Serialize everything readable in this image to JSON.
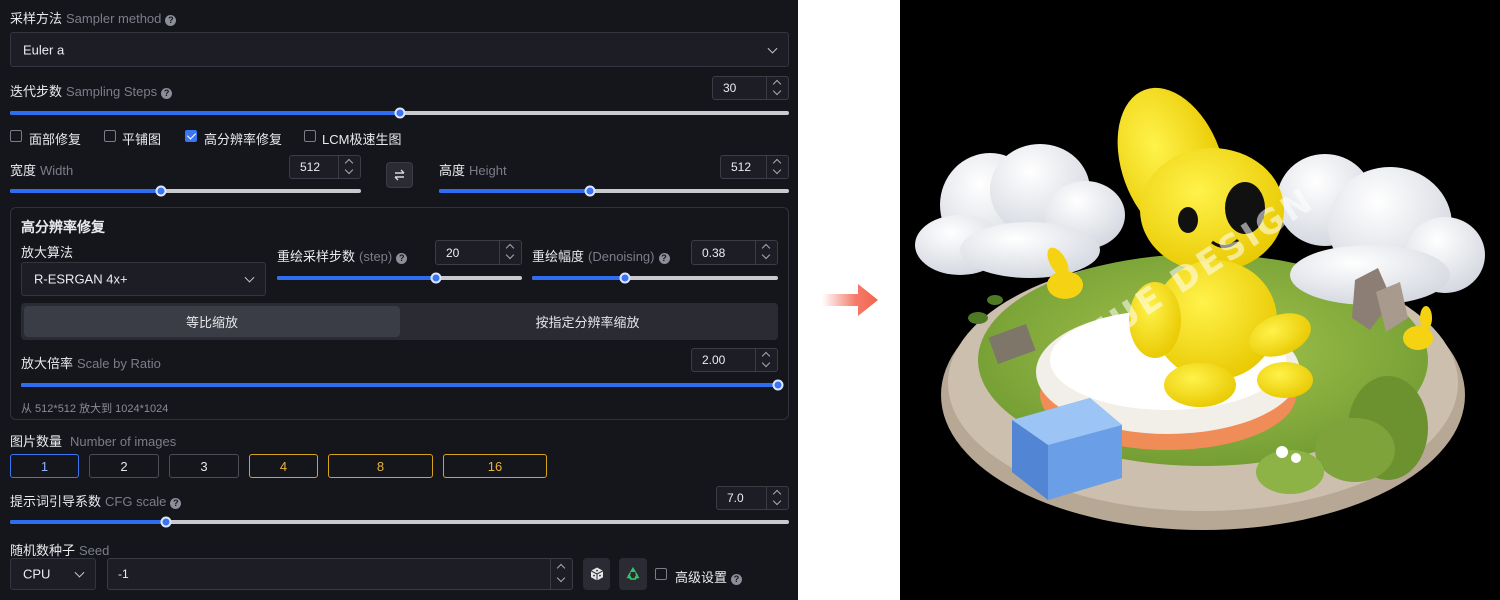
{
  "sampler": {
    "label": "采样方法",
    "sub": "Sampler method",
    "value": "Euler a"
  },
  "steps": {
    "label": "迭代步数",
    "sub": "Sampling Steps",
    "value": "30",
    "level": 0.5
  },
  "options": [
    {
      "label": "面部修复",
      "checked": false
    },
    {
      "label": "平铺图",
      "checked": false
    },
    {
      "label": "高分辨率修复",
      "checked": true
    },
    {
      "label": "LCM极速生图",
      "checked": false
    }
  ],
  "width": {
    "label": "宽度",
    "sub": "Width",
    "value": "512",
    "level": 0.43
  },
  "height": {
    "label": "高度",
    "sub": "Height",
    "value": "512",
    "level": 0.43
  },
  "hires": {
    "title": "高分辨率修复",
    "upscaler_label": "放大算法",
    "upscaler_value": "R-ESRGAN 4x+",
    "hires_steps_label": "重绘采样步数",
    "hires_steps_sub": "(step)",
    "hires_steps_value": "20",
    "hires_steps_level": 0.65,
    "denoise_label": "重绘幅度",
    "denoise_sub": "(Denoising)",
    "denoise_value": "0.38",
    "denoise_level": 0.38,
    "mode_tabs": [
      "等比缩放",
      "按指定分辨率缩放"
    ],
    "scale_label": "放大倍率",
    "scale_sub": "Scale by Ratio",
    "scale_value": "2.00",
    "scale_level": 1.0,
    "scale_note": "从 512*512 放大到 1024*1024"
  },
  "images": {
    "label": "图片数量",
    "sub": "Number of images",
    "choices": [
      "1",
      "2",
      "3",
      "4",
      "8",
      "16"
    ]
  },
  "cfg": {
    "label": "提示词引导系数",
    "sub": "CFG scale",
    "value": "7.0",
    "level": 0.2
  },
  "seed": {
    "label": "随机数种子",
    "sub": "Seed",
    "device": "CPU",
    "value": "-1",
    "advanced_label": "高级设置"
  },
  "preview": {
    "watermark": "JUE DESIGN"
  },
  "colors": {
    "panel": "#15161c",
    "accent": "#2f6df0",
    "gold": "#d9a21b",
    "arrow": "#f2644e"
  }
}
